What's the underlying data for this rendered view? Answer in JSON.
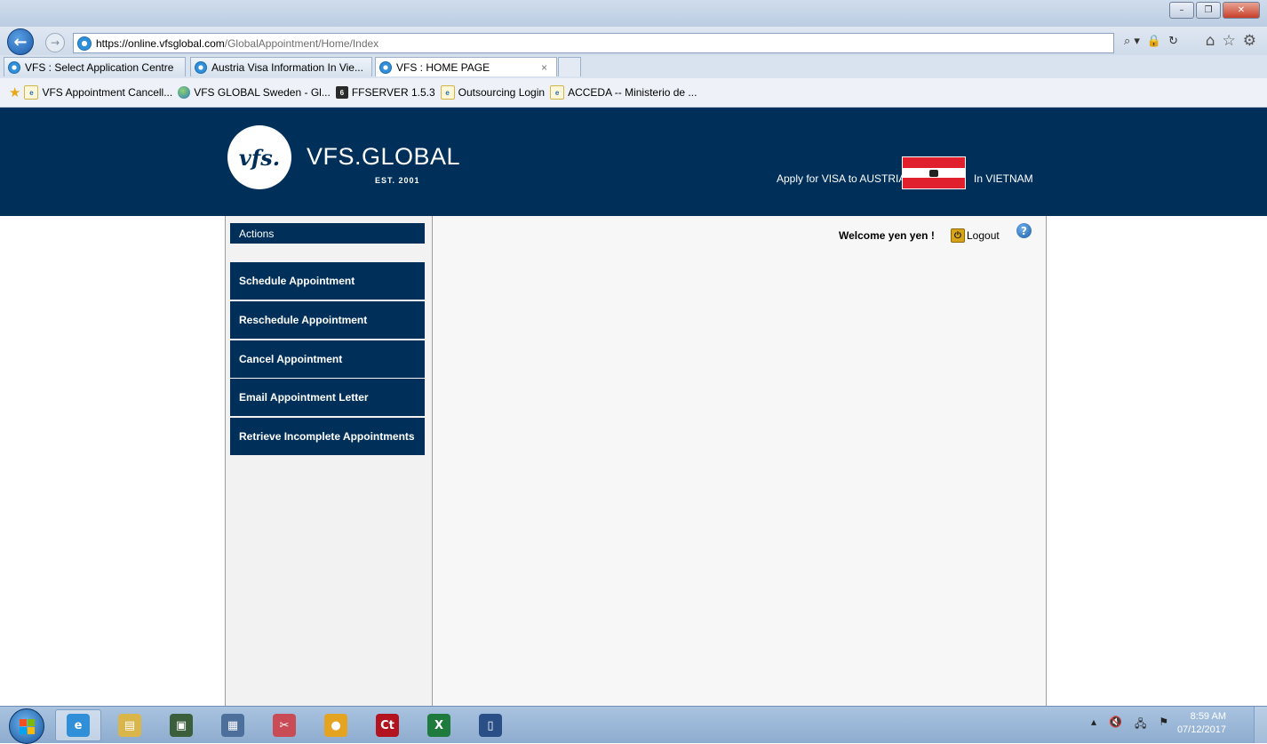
{
  "browser": {
    "window_buttons": {
      "minimize": "–",
      "restore": "❐",
      "close": "✕"
    },
    "address": {
      "host": "https://online.vfsglobal.com",
      "path": "/GlobalAppointment/Home/Index"
    },
    "address_tools": [
      "⌕ ▾",
      "🔒",
      "↻"
    ],
    "tools": [
      "⌂",
      "☆",
      "⚙"
    ],
    "tabs": [
      {
        "label": "VFS : Select Application Centre",
        "active": false
      },
      {
        "label": "Austria Visa Information In Vie...",
        "active": false
      },
      {
        "label": "VFS : HOME PAGE",
        "active": true,
        "close": "×"
      }
    ],
    "favorites": [
      {
        "label": "VFS  Appointment Cancell...",
        "icon": "ie-page-icon"
      },
      {
        "label": "VFS GLOBAL  Sweden - Gl...",
        "icon": "globe-icon"
      },
      {
        "label": "FFSERVER 1.5.3",
        "icon": "ffserver-icon"
      },
      {
        "label": "Outsourcing Login",
        "icon": "ie-page-icon"
      },
      {
        "label": "ACCEDA -- Ministerio de ...",
        "icon": "ie-page-icon"
      }
    ]
  },
  "header": {
    "logo_mark": "vfs.",
    "brand_name": "VFS.GLOBAL",
    "brand_est": "EST. 2001",
    "apply_text": "Apply for VISA to AUSTRIA",
    "country_text": "In VIETNAM",
    "colors": {
      "navy": "#00305a",
      "flag_red": "#e0202c"
    }
  },
  "sidebar": {
    "heading": "Actions",
    "items": [
      {
        "label": "Schedule Appointment"
      },
      {
        "label": "Reschedule Appointment"
      },
      {
        "label": "Cancel Appointment"
      },
      {
        "label": "Email Appointment Letter"
      },
      {
        "label": "Retrieve Incomplete Appointments"
      }
    ]
  },
  "topbar": {
    "welcome": "Welcome yen yen !",
    "logout": "Logout",
    "help": "?"
  },
  "taskbar": {
    "apps": [
      {
        "name": "internet-explorer-icon",
        "glyph": "e",
        "color": "#2f8fd8",
        "active": true
      },
      {
        "name": "file-explorer-icon",
        "glyph": "▤",
        "color": "#d9b54a",
        "active": false
      },
      {
        "name": "terminal-icon",
        "glyph": "▣",
        "color": "#3b5e3b",
        "active": false
      },
      {
        "name": "network-icon",
        "glyph": "▦",
        "color": "#4d6f9c",
        "active": false
      },
      {
        "name": "snipping-tool-icon",
        "glyph": "✂",
        "color": "#c84b55",
        "active": false
      },
      {
        "name": "chrome-icon",
        "glyph": "●",
        "color": "#e4a321",
        "active": false
      },
      {
        "name": "ct-app-icon",
        "glyph": "Ct",
        "color": "#b3121f",
        "active": false
      },
      {
        "name": "excel-icon",
        "glyph": "X",
        "color": "#1f7a3e",
        "active": false
      },
      {
        "name": "app-window-icon",
        "glyph": "▯",
        "color": "#2a4f86",
        "active": false
      }
    ],
    "tray": [
      "▴",
      "🔇",
      "🖧",
      "⚑"
    ],
    "time": "8:59 AM",
    "date": "07/12/2017"
  }
}
